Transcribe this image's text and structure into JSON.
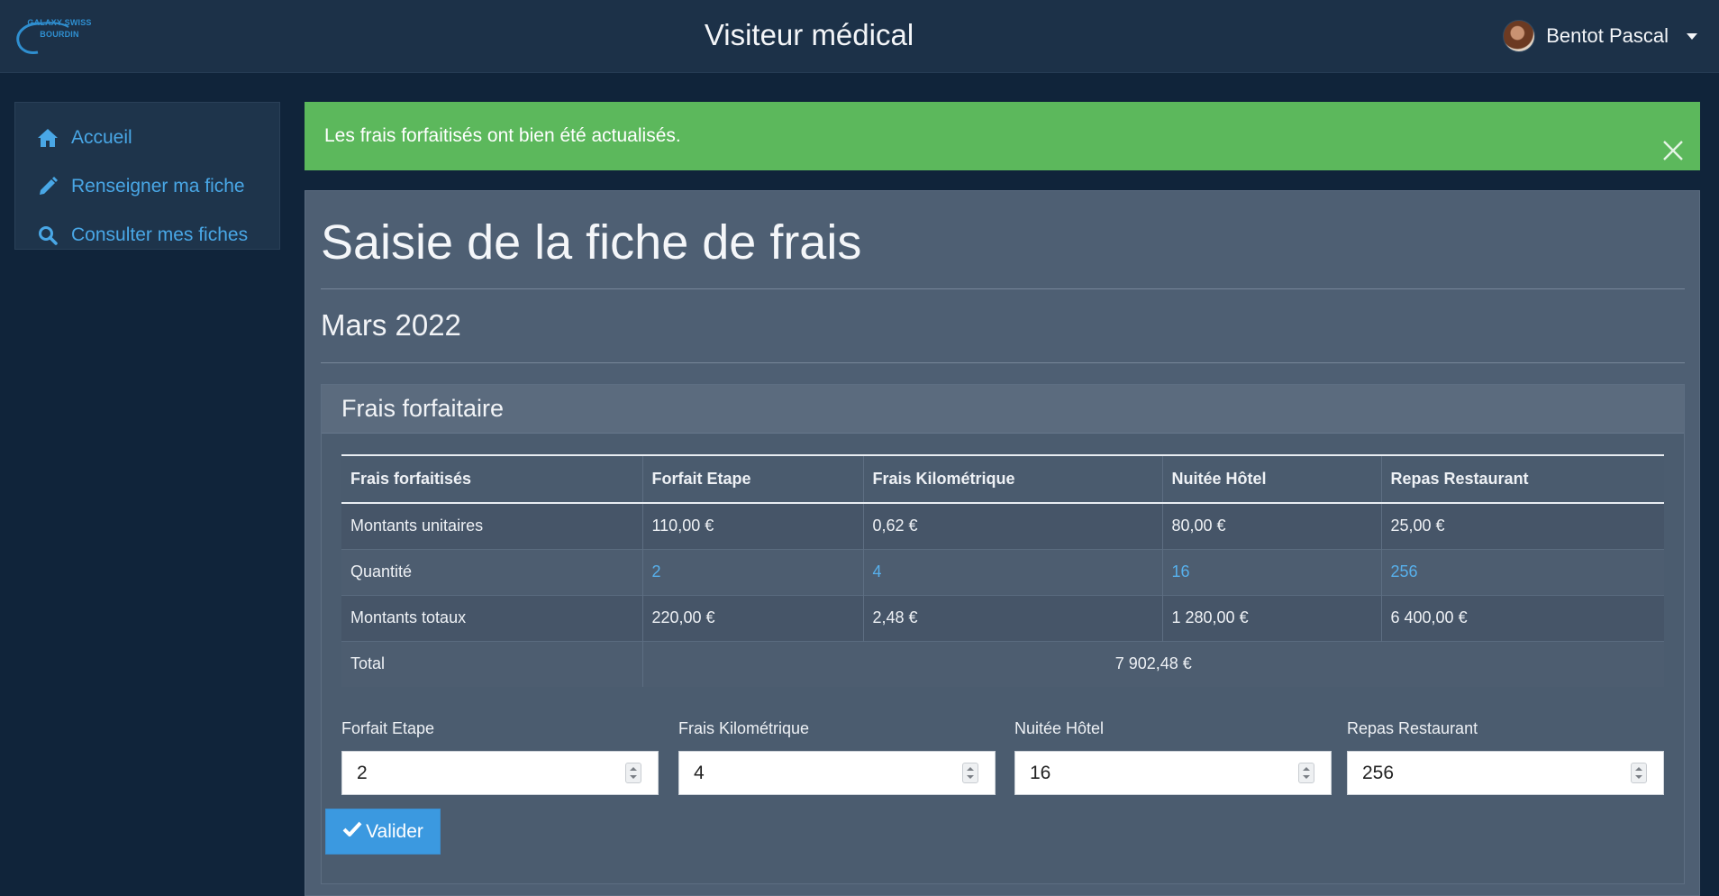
{
  "navbar": {
    "logo_text": "GALAXY SWISS BOURDIN",
    "title": "Visiteur médical",
    "user_name": "Bentot Pascal"
  },
  "sidebar": {
    "items": [
      {
        "label": "Accueil",
        "icon": "home-icon"
      },
      {
        "label": "Renseigner ma fiche",
        "icon": "pencil-icon"
      },
      {
        "label": "Consulter mes fiches",
        "icon": "search-icon"
      }
    ]
  },
  "alert": {
    "message": "Les frais forfaitisés ont bien été actualisés.",
    "color": "#5cb85c"
  },
  "main": {
    "title": "Saisie de la fiche de frais",
    "month": "Mars 2022",
    "card_title": "Frais forfaitaire",
    "table": {
      "headers": [
        "Frais forfaitisés",
        "Forfait Etape",
        "Frais Kilométrique",
        "Nuitée Hôtel",
        "Repas Restaurant"
      ],
      "rows": [
        {
          "label": "Montants unitaires",
          "values": [
            "110,00 €",
            "0,62 €",
            "80,00 €",
            "25,00 €"
          ]
        },
        {
          "label": "Quantité",
          "values": [
            "2",
            "4",
            "16",
            "256"
          ]
        },
        {
          "label": "Montants totaux",
          "values": [
            "220,00 €",
            "2,48 €",
            "1 280,00 €",
            "6 400,00 €"
          ]
        }
      ],
      "total_label": "Total",
      "total_value": "7 902,48 €"
    },
    "inputs": [
      {
        "label": "Forfait Etape",
        "value": "2"
      },
      {
        "label": "Frais Kilométrique",
        "value": "4"
      },
      {
        "label": "Nuitée Hôtel",
        "value": "16"
      },
      {
        "label": "Repas Restaurant",
        "value": "256"
      }
    ],
    "submit_label": "Valider"
  },
  "colors": {
    "accent": "#49a7e6",
    "button": "#3b99e0",
    "panel": "#4e5f73",
    "background": "#10243a"
  }
}
